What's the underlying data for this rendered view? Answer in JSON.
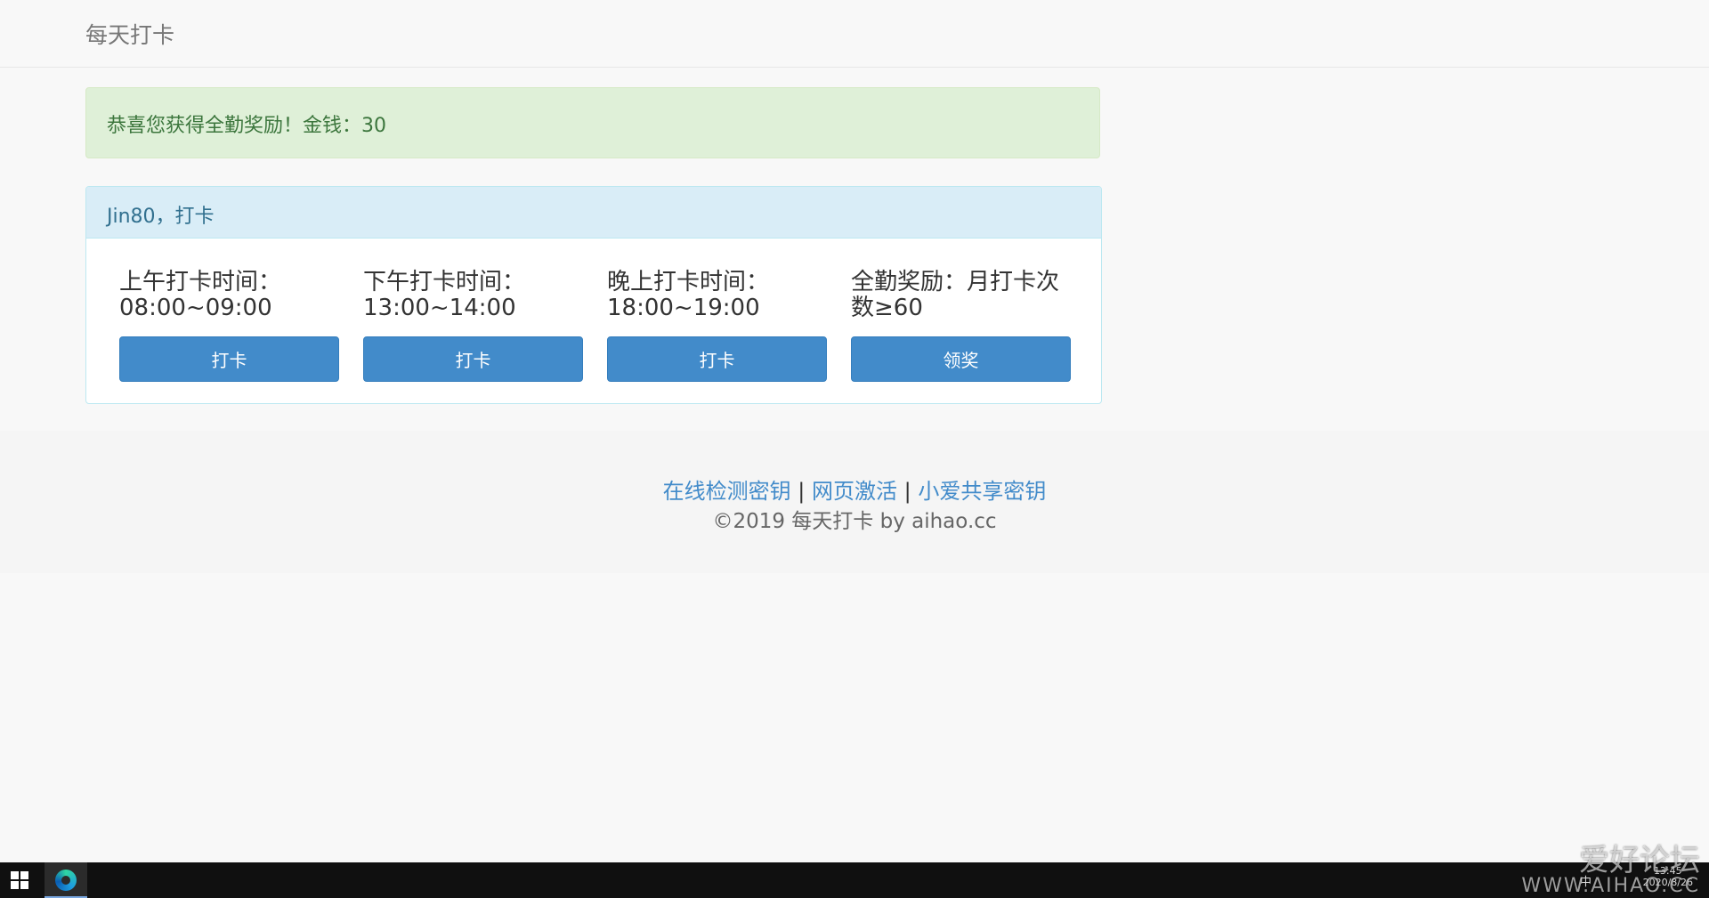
{
  "navbar": {
    "brand": "每天打卡"
  },
  "alert": {
    "message": "恭喜您获得全勤奖励！金钱：30"
  },
  "panel": {
    "heading": "Jin80，打卡",
    "columns": [
      {
        "text": "上午打卡时间：08:00~09:00",
        "button": "打卡"
      },
      {
        "text": "下午打卡时间：13:00~14:00",
        "button": "打卡"
      },
      {
        "text": "晚上打卡时间：18:00~19:00",
        "button": "打卡"
      },
      {
        "text": "全勤奖励：月打卡次数≥60",
        "button": "领奖"
      }
    ]
  },
  "footer": {
    "links": [
      "在线检测密钥",
      "网页激活",
      "小爱共享密钥"
    ],
    "separator": "|",
    "copyright": "©2019 每天打卡 by aihao.cc"
  },
  "taskbar": {
    "ime": "中",
    "time": "13:45",
    "date": "2020/8/26"
  },
  "watermark": {
    "title": "爱好论坛",
    "url": "WWW.AIHAO.CC"
  }
}
